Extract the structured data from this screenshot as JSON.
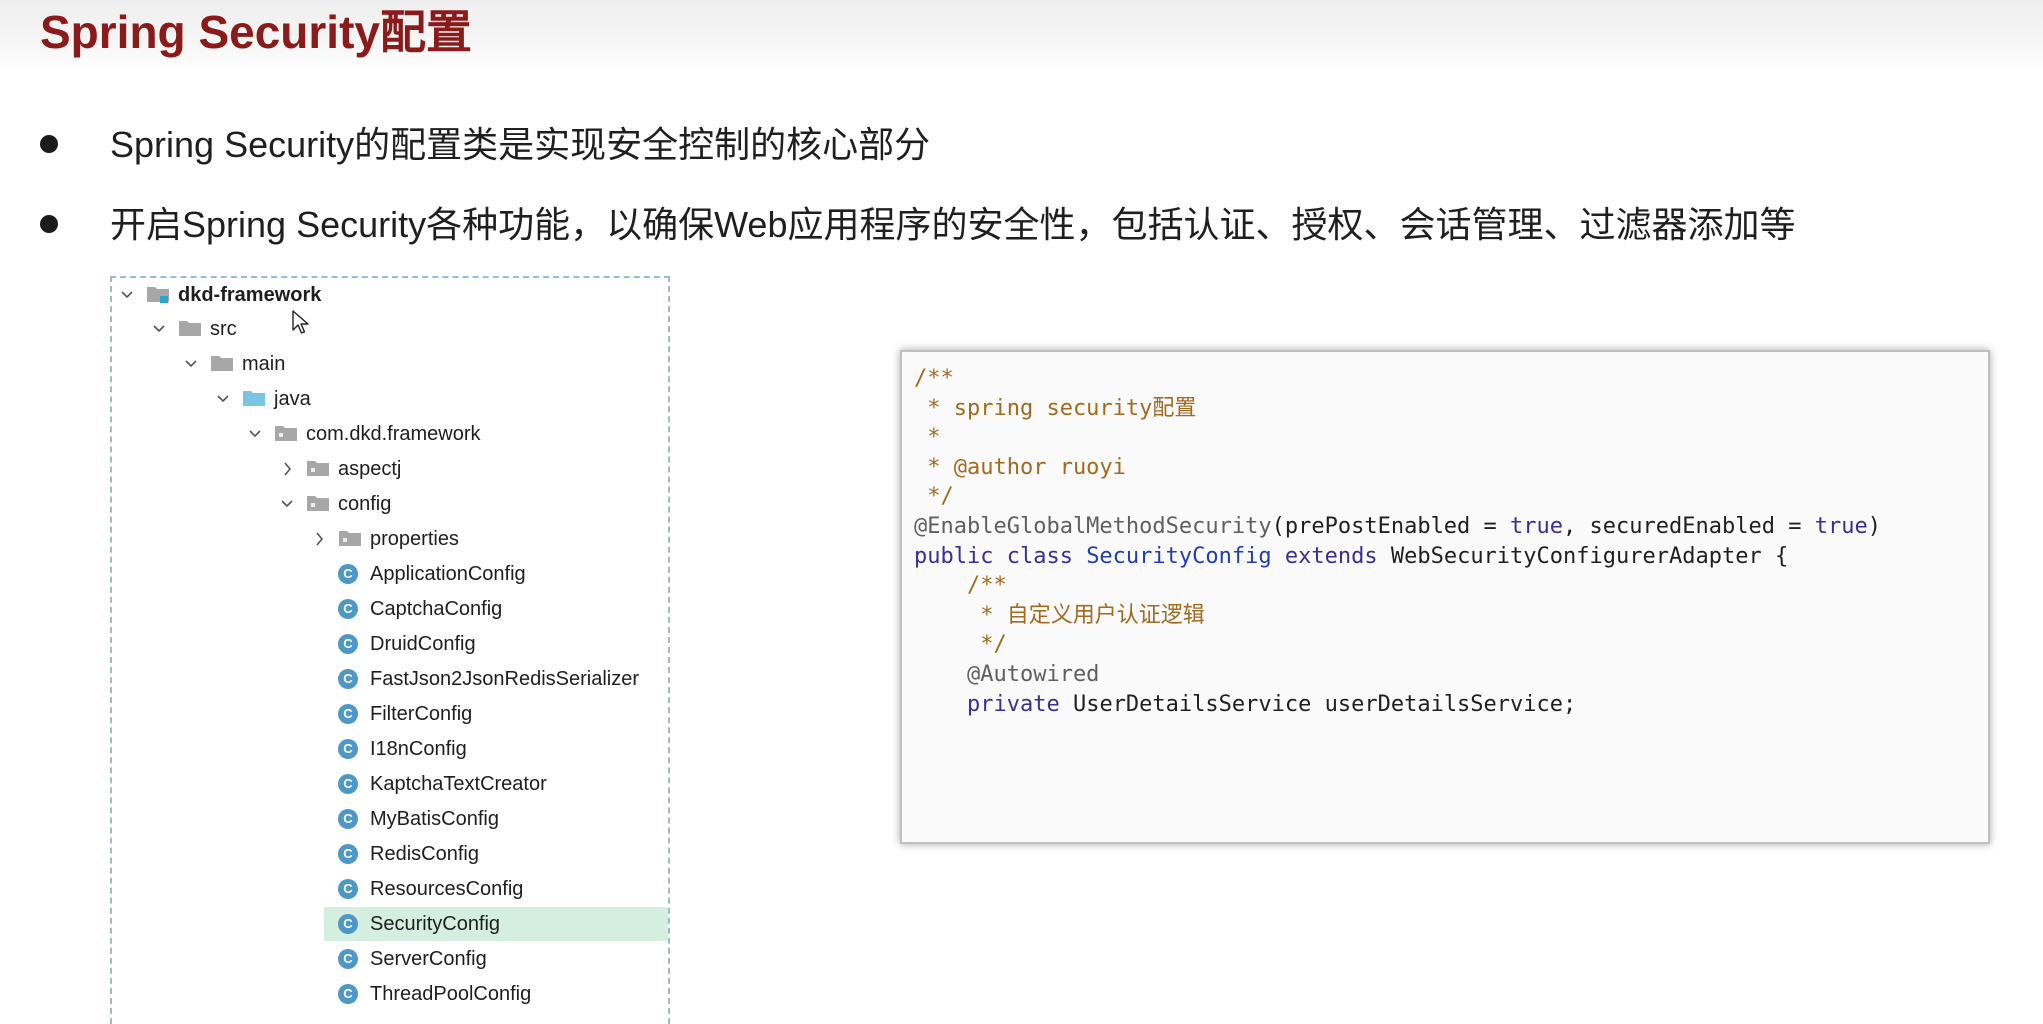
{
  "slide": {
    "title": "Spring Security配置",
    "bullets": [
      "Spring Security的配置类是实现安全控制的核心部分",
      "开启Spring Security各种功能，以确保Web应用程序的安全性，包括认证、授权、会话管理、过滤器添加等"
    ]
  },
  "tree": {
    "items": [
      {
        "label": "dkd-framework",
        "kind": "module",
        "expanded": true
      },
      {
        "label": "src",
        "kind": "folder",
        "expanded": true
      },
      {
        "label": "main",
        "kind": "folder",
        "expanded": true
      },
      {
        "label": "java",
        "kind": "source-folder",
        "expanded": true
      },
      {
        "label": "com.dkd.framework",
        "kind": "package",
        "expanded": true
      },
      {
        "label": "aspectj",
        "kind": "package",
        "expanded": false
      },
      {
        "label": "config",
        "kind": "package",
        "expanded": true
      },
      {
        "label": "properties",
        "kind": "package",
        "expanded": false
      },
      {
        "label": "ApplicationConfig",
        "kind": "class"
      },
      {
        "label": "CaptchaConfig",
        "kind": "class"
      },
      {
        "label": "DruidConfig",
        "kind": "class"
      },
      {
        "label": "FastJson2JsonRedisSerializer",
        "kind": "class"
      },
      {
        "label": "FilterConfig",
        "kind": "class"
      },
      {
        "label": "I18nConfig",
        "kind": "class"
      },
      {
        "label": "KaptchaTextCreator",
        "kind": "class"
      },
      {
        "label": "MyBatisConfig",
        "kind": "class"
      },
      {
        "label": "RedisConfig",
        "kind": "class"
      },
      {
        "label": "ResourcesConfig",
        "kind": "class"
      },
      {
        "label": "SecurityConfig",
        "kind": "class",
        "selected": true
      },
      {
        "label": "ServerConfig",
        "kind": "class"
      },
      {
        "label": "ThreadPoolConfig",
        "kind": "class"
      }
    ],
    "class_icon_letter": "C",
    "selected_color": "#d4eedf"
  },
  "code": {
    "lines": [
      [
        {
          "t": "/**",
          "s": "comment"
        }
      ],
      [
        {
          "t": " * spring security配置",
          "s": "comment"
        }
      ],
      [
        {
          "t": " *",
          "s": "comment"
        }
      ],
      [
        {
          "t": " * @author ruoyi",
          "s": "comment"
        }
      ],
      [
        {
          "t": " */",
          "s": "comment"
        }
      ],
      [
        {
          "t": "@EnableGlobalMethodSecurity",
          "s": "anno"
        },
        {
          "t": "(prePostEnabled = ",
          "s": "plain"
        },
        {
          "t": "true",
          "s": "kw"
        },
        {
          "t": ", securedEnabled = ",
          "s": "plain"
        },
        {
          "t": "true",
          "s": "kw"
        },
        {
          "t": ")",
          "s": "plain"
        }
      ],
      [
        {
          "t": "public class ",
          "s": "kw"
        },
        {
          "t": "SecurityConfig",
          "s": "type"
        },
        {
          "t": " extends ",
          "s": "kw"
        },
        {
          "t": "WebSecurityConfigurerAdapter {",
          "s": "plain"
        }
      ],
      [
        {
          "t": "    /**",
          "s": "comment"
        }
      ],
      [
        {
          "t": "     * 自定义用户认证逻辑",
          "s": "comment"
        }
      ],
      [
        {
          "t": "     */",
          "s": "comment"
        }
      ],
      [
        {
          "t": "    @Autowired",
          "s": "anno"
        }
      ],
      [
        {
          "t": "    private ",
          "s": "kw"
        },
        {
          "t": "UserDetailsService userDetailsService;",
          "s": "plain"
        }
      ]
    ]
  },
  "colors": {
    "title": "#8b1a1a",
    "comment": "#a26a1f",
    "keyword": "#3b2d94",
    "class_icon": "#4e98c7"
  }
}
